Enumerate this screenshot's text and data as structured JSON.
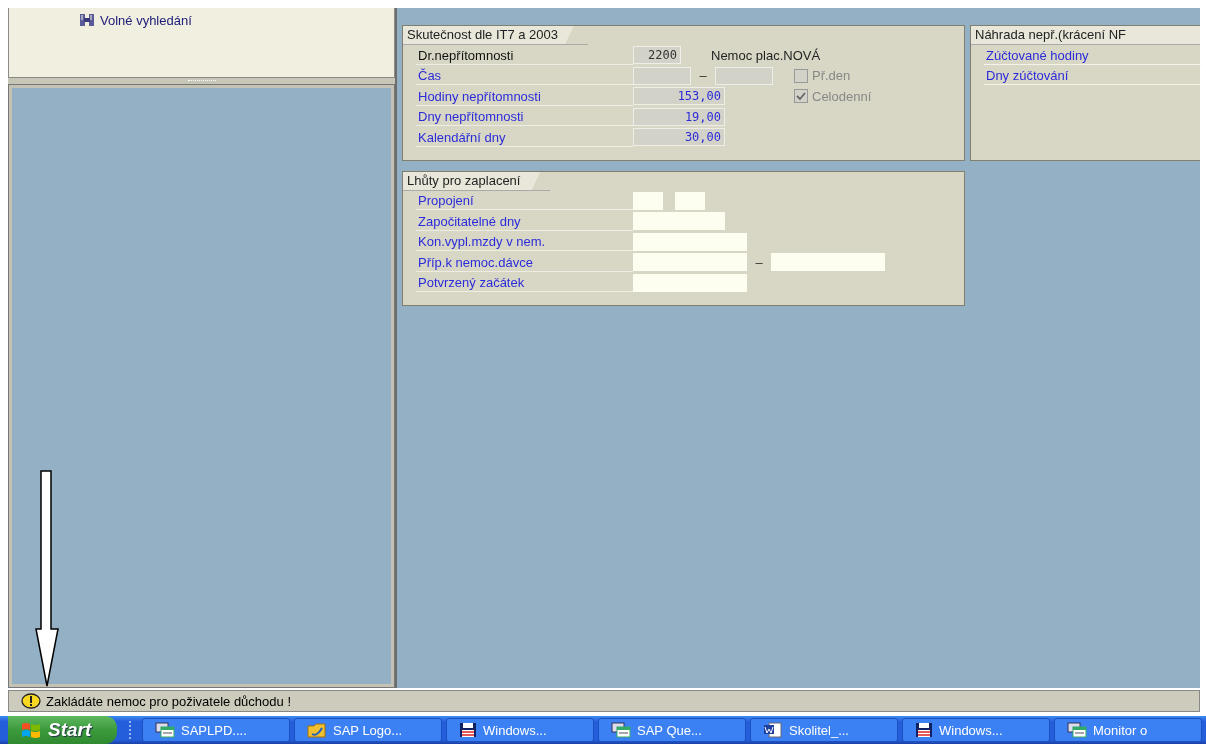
{
  "tree": {
    "items": [
      {
        "label": "Volné vyhledání"
      }
    ]
  },
  "groups": [
    {
      "title": "Skutečnost dle IT7 a 2003",
      "kind": "main",
      "rows": [
        {
          "kind": "caption",
          "label": "Dr.nepřítomnosti",
          "fields": [
            {
              "kind": "code",
              "value": "2200",
              "editable": false
            }
          ],
          "description": "Nemoc plac.NOVÁ"
        },
        {
          "kind": "field",
          "label": "Čas",
          "fields": [
            {
              "kind": "time",
              "editable": false
            },
            {
              "kind": "time",
              "editable": false
            }
          ],
          "separator": "–",
          "checkbox": {
            "label": "Př.den",
            "checked": false,
            "disabled": true
          }
        },
        {
          "kind": "field",
          "label": "Hodiny nepřítomnosti",
          "fields": [
            {
              "kind": "amount",
              "value": "153,00",
              "editable": false
            }
          ],
          "checkbox": {
            "label": "Celodenní",
            "checked": true,
            "disabled": true
          }
        },
        {
          "kind": "field",
          "label": "Dny nepřítomnosti",
          "fields": [
            {
              "kind": "amount",
              "value": "19,00",
              "editable": false
            }
          ]
        },
        {
          "kind": "field",
          "label": "Kalendářní dny",
          "fields": [
            {
              "kind": "amount",
              "value": "30,00",
              "editable": false
            }
          ]
        }
      ]
    },
    {
      "title": "Náhrada nepř.(krácení NF",
      "kind": "side",
      "rows": [
        {
          "kind": "field",
          "label": "Zúčtované hodiny"
        },
        {
          "kind": "field",
          "label": "Dny zúčtování"
        }
      ]
    },
    {
      "title": "Lhůty pro zaplacení",
      "kind": "main",
      "rows": [
        {
          "kind": "field",
          "label": "Propojení",
          "fields": [
            {
              "kind": "short",
              "editable": true
            },
            {
              "kind": "short",
              "editable": true
            }
          ]
        },
        {
          "kind": "field",
          "label": "Započitatelné dny",
          "fields": [
            {
              "kind": "amount",
              "editable": true
            }
          ]
        },
        {
          "kind": "field",
          "label": "Kon.vypl.mzdy v nem.",
          "fields": [
            {
              "kind": "date",
              "editable": true
            }
          ]
        },
        {
          "kind": "field",
          "label": "Příp.k nemoc.dávce",
          "fields": [
            {
              "kind": "date",
              "editable": true
            },
            {
              "kind": "date",
              "editable": true
            }
          ],
          "separator": "–"
        },
        {
          "kind": "field",
          "label": "Potvrzený začátek",
          "fields": [
            {
              "kind": "date",
              "editable": true
            }
          ]
        }
      ]
    }
  ],
  "status_bar": {
    "kind": "warning",
    "message": "Zakládáte nemoc pro poživatele důchodu !"
  },
  "taskbar": {
    "start": "Start",
    "tasks": [
      {
        "kind": "app",
        "label": "SAPLPD...."
      },
      {
        "kind": "folder",
        "label": "SAP Logo..."
      },
      {
        "kind": "disk",
        "label": "Windows..."
      },
      {
        "kind": "app",
        "label": "SAP Que..."
      },
      {
        "kind": "doc",
        "label": "Skolitel_..."
      },
      {
        "kind": "disk",
        "label": "Windows..."
      },
      {
        "kind": "app",
        "label": "Monitor o"
      }
    ]
  }
}
